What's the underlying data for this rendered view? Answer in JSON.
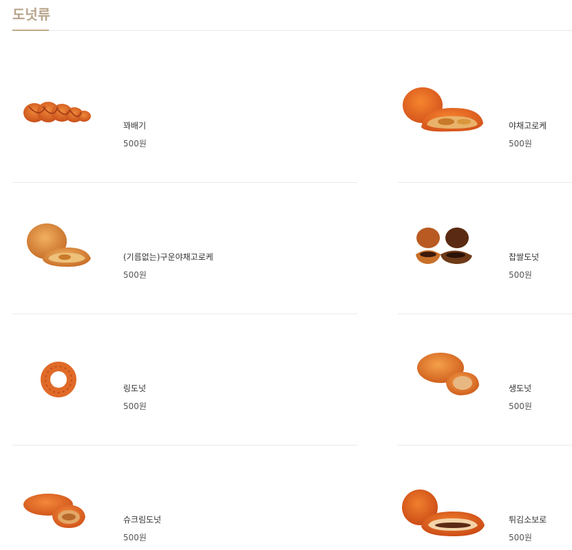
{
  "category": {
    "title": "도넛류"
  },
  "products": [
    {
      "name": "꽈배기",
      "price": "500원",
      "image_icon": "twisted-donut-icon"
    },
    {
      "name": "야채고로케",
      "price": "500원",
      "image_icon": "vegetable-croquette-icon"
    },
    {
      "name": "(기름없는)구운야채고로케",
      "price": "500원",
      "image_icon": "baked-croquette-icon"
    },
    {
      "name": "찹쌀도넛",
      "price": "500원",
      "image_icon": "glutinous-rice-donut-icon"
    },
    {
      "name": "링도넛",
      "price": "500원",
      "image_icon": "ring-donut-icon"
    },
    {
      "name": "생도넛",
      "price": "500원",
      "image_icon": "cream-donut-icon"
    },
    {
      "name": "슈크림도넛",
      "price": "500원",
      "image_icon": "custard-donut-icon"
    },
    {
      "name": "튀김소보로",
      "price": "500원",
      "image_icon": "fried-soboro-icon"
    }
  ]
}
